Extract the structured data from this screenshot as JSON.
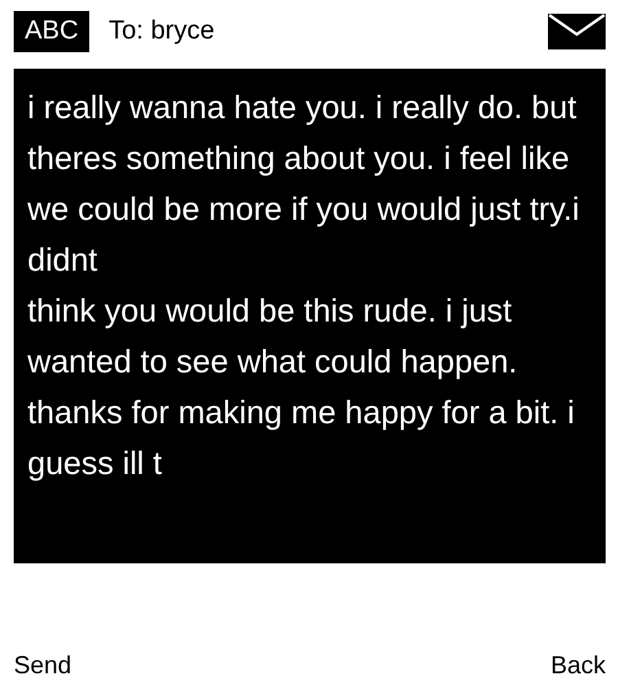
{
  "header": {
    "input_mode": "ABC",
    "recipient": "To: bryce"
  },
  "message": {
    "text": "i really wanna hate you. i really do. but theres something about you. i feel like we could be more if you would just try.i didnt\nthink you would be this rude. i just wanted to see what could happen. thanks for making me happy for a bit. i guess ill t"
  },
  "softkeys": {
    "left": "Send",
    "right": "Back"
  }
}
